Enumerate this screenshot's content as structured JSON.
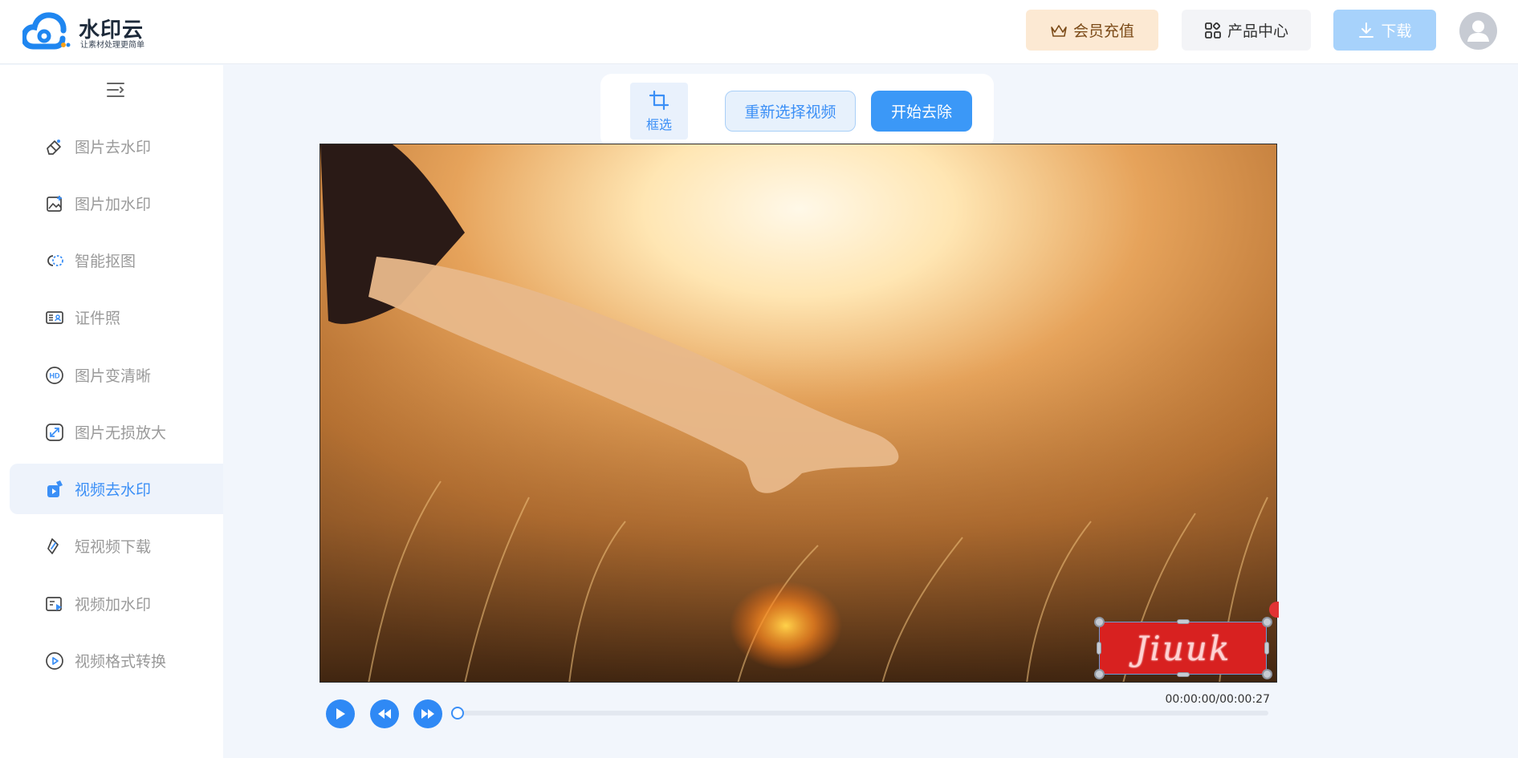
{
  "app": {
    "logo_title": "水印云",
    "logo_subtitle": "让素材处理更简单",
    "brand_color": "#3b8ff6"
  },
  "header": {
    "vip_label": "会员充值",
    "product_label": "产品中心",
    "download_label": "下载"
  },
  "sidebar": {
    "items": [
      {
        "label": "图片去水印",
        "icon": "eraser-icon"
      },
      {
        "label": "图片加水印",
        "icon": "image-add-icon"
      },
      {
        "label": "智能抠图",
        "icon": "cutout-icon"
      },
      {
        "label": "证件照",
        "icon": "id-card-icon"
      },
      {
        "label": "图片变清晰",
        "icon": "hd-icon"
      },
      {
        "label": "图片无损放大",
        "icon": "enlarge-icon"
      },
      {
        "label": "视频去水印",
        "icon": "video-eraser-icon",
        "active": true
      },
      {
        "label": "短视频下载",
        "icon": "link-icon"
      },
      {
        "label": "视频加水印",
        "icon": "video-add-icon"
      },
      {
        "label": "视频格式转换",
        "icon": "convert-icon"
      }
    ]
  },
  "toolbar": {
    "crop_label": "框选",
    "reselect_label": "重新选择视频",
    "start_label": "开始去除"
  },
  "video": {
    "watermark_text": "Jiuuk",
    "current_time": "00:00:00",
    "total_time": "00:00:27",
    "time_display": "00:00:00/00:00:27",
    "progress": 0
  }
}
